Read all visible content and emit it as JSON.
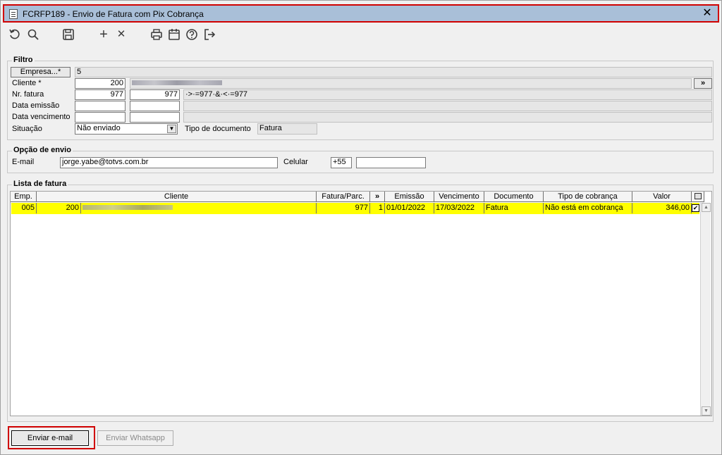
{
  "window": {
    "title": "FCRFP189 - Envio de Fatura com Pix Cobrança",
    "close_glyph": "✕"
  },
  "toolbar": {
    "icons": [
      "undo-icon",
      "search-icon",
      "save-icon",
      "add-icon",
      "delete-icon",
      "print-icon",
      "calendar-icon",
      "help-icon",
      "exit-icon"
    ],
    "add_glyph": "+",
    "delete_glyph": "✕"
  },
  "filtro": {
    "title": "Filtro",
    "empresa_button": "Empresa...*",
    "empresa_value": "5",
    "cliente_label": "Cliente *",
    "cliente_value": "200",
    "cliente_more_button": "»",
    "nr_fatura_label": "Nr. fatura",
    "nr_fatura_from": "977",
    "nr_fatura_to": "977",
    "nr_fatura_expr": "·>·=977·&·<·=977",
    "data_emissao_label": "Data emissão",
    "data_vencimento_label": "Data vencimento",
    "situacao_label": "Situação",
    "situacao_value": "Não enviado",
    "tipo_documento_label": "Tipo de documento",
    "tipo_documento_value": "Fatura"
  },
  "opcao_envio": {
    "title": "Opção de envio",
    "email_label": "E-mail",
    "email_value": "jorge.yabe@totvs.com.br",
    "celular_label": "Celular",
    "celular_ddi": "+55",
    "celular_value": ""
  },
  "lista": {
    "title": "Lista de fatura",
    "columns": [
      "Emp.",
      "Cliente",
      "Fatura/Parc.",
      "»",
      "Emissão",
      "Vencimento",
      "Documento",
      "Tipo de cobrança",
      "Valor"
    ],
    "rows": [
      {
        "emp": "005",
        "cliente_cod": "200",
        "fatura": "977",
        "parc": "1",
        "emissao": "01/01/2022",
        "vencimento": "17/03/2022",
        "documento": "Fatura",
        "tipo_cobranca": "Não está em cobrança",
        "valor": "346,00",
        "checked": true
      }
    ],
    "check_glyph": "✔",
    "row_highlight_color": "#ffff00"
  },
  "footer": {
    "email_button": "Enviar e-mail",
    "whatsapp_button": "Enviar Whatsapp"
  }
}
